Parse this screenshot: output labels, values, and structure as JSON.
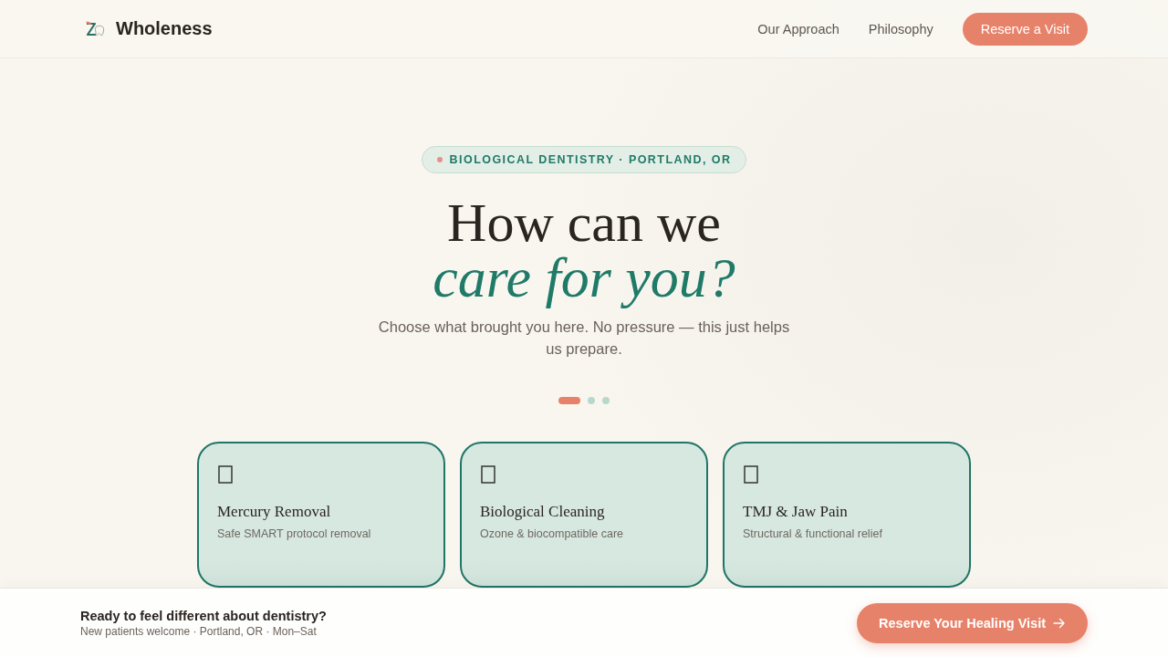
{
  "header": {
    "brand": "Wholeness",
    "nav": [
      {
        "label": "Our Approach"
      },
      {
        "label": "Philosophy"
      }
    ],
    "cta": "Reserve a Visit"
  },
  "hero": {
    "badge": "BIOLOGICAL DENTISTRY · PORTLAND, OR",
    "title": "How can we",
    "title_accent": "care for you?",
    "subtitle": "Choose what brought you here. No pressure — this just helps us prepare."
  },
  "pager": [
    {
      "selected": true
    },
    {
      "selected": false
    },
    {
      "selected": false
    }
  ],
  "services": [
    {
      "title": "Mercury Removal",
      "description": "Safe SMART protocol removal"
    },
    {
      "title": "Biological Cleaning",
      "description": "Ozone & biocompatible care"
    },
    {
      "title": "TMJ & Jaw Pain",
      "description": "Structural & functional relief"
    }
  ],
  "footer_bar": {
    "title": "Ready to feel different about dentistry?",
    "subtitle": "New patients welcome · Portland, OR · Mon–Sat",
    "cta": "Reserve Your Healing Visit"
  }
}
